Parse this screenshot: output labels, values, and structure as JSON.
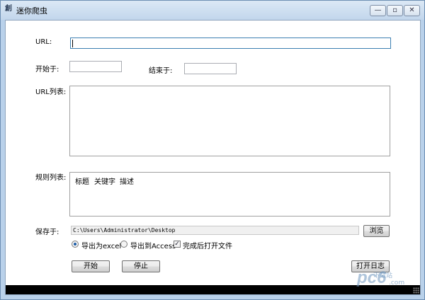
{
  "window": {
    "title": "迷你爬虫",
    "app_icon": "spider-app-icon",
    "controls": {
      "minimize": "—",
      "maximize": "▫",
      "close": "✕"
    }
  },
  "form": {
    "url_label": "URL:",
    "url_value": "",
    "start_label": "开始于:",
    "start_value": "",
    "end_label": "结束于:",
    "end_value": "",
    "url_list_label": "URL列表:",
    "url_list_value": "",
    "rules_label": "规则列表:",
    "rules_columns": [
      "标题",
      "关键字",
      "描述"
    ],
    "save_label": "保存于:",
    "save_path": "C:\\Users\\Administrator\\Desktop",
    "browse_button": "浏览",
    "export_excel_label": "导出为excel",
    "export_access_label": "导出到Access",
    "open_after_label": "完成后打开文件",
    "export_selected": "excel",
    "open_after_checked": true,
    "start_button": "开始",
    "stop_button": "停止",
    "log_button": "打开日志"
  },
  "watermark": {
    "text": "pc6",
    "sub": "下载站",
    "suffix": ".com"
  }
}
